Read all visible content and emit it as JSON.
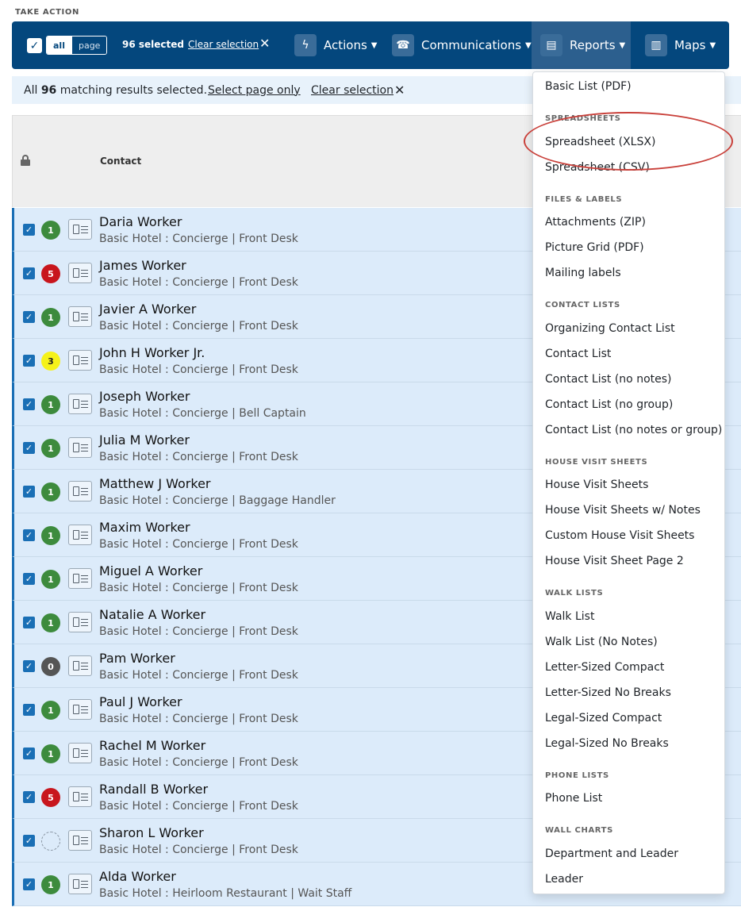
{
  "header": {
    "take_action": "TAKE ACTION"
  },
  "toolbar": {
    "seg_all": "all",
    "seg_page": "page",
    "selected_count": "96 selected",
    "clear_selection": "Clear selection",
    "actions": "Actions",
    "communications": "Communications",
    "reports": "Reports",
    "maps": "Maps"
  },
  "banner": {
    "prefix": "All ",
    "count": "96",
    "suffix": " matching results selected.",
    "select_page_only": "Select page only",
    "clear_selection": "Clear selection"
  },
  "table": {
    "col_contact": "Contact"
  },
  "rows": [
    {
      "name": "Daria Worker",
      "sub": "Basic Hotel : Concierge | Front Desk",
      "badge": "1",
      "badge_color": "#3d8b3d"
    },
    {
      "name": "James Worker",
      "sub": "Basic Hotel : Concierge | Front Desk",
      "badge": "5",
      "badge_color": "#c8161d"
    },
    {
      "name": "Javier A Worker",
      "sub": "Basic Hotel : Concierge | Front Desk",
      "badge": "1",
      "badge_color": "#3d8b3d"
    },
    {
      "name": "John H Worker Jr.",
      "sub": "Basic Hotel : Concierge | Front Desk",
      "badge": "3",
      "badge_color": "#f5f21a"
    },
    {
      "name": "Joseph Worker",
      "sub": "Basic Hotel : Concierge | Bell Captain",
      "badge": "1",
      "badge_color": "#3d8b3d"
    },
    {
      "name": "Julia M Worker",
      "sub": "Basic Hotel : Concierge | Front Desk",
      "badge": "1",
      "badge_color": "#3d8b3d"
    },
    {
      "name": "Matthew J Worker",
      "sub": "Basic Hotel : Concierge | Baggage Handler",
      "badge": "1",
      "badge_color": "#3d8b3d"
    },
    {
      "name": "Maxim Worker",
      "sub": "Basic Hotel : Concierge | Front Desk",
      "badge": "1",
      "badge_color": "#3d8b3d"
    },
    {
      "name": "Miguel A Worker",
      "sub": "Basic Hotel : Concierge | Front Desk",
      "badge": "1",
      "badge_color": "#3d8b3d"
    },
    {
      "name": "Natalie A Worker",
      "sub": "Basic Hotel : Concierge | Front Desk",
      "badge": "1",
      "badge_color": "#3d8b3d"
    },
    {
      "name": "Pam Worker",
      "sub": "Basic Hotel : Concierge | Front Desk",
      "badge": "0",
      "badge_color": "#555555"
    },
    {
      "name": "Paul J Worker",
      "sub": "Basic Hotel : Concierge | Front Desk",
      "badge": "1",
      "badge_color": "#3d8b3d"
    },
    {
      "name": "Rachel M Worker",
      "sub": "Basic Hotel : Concierge | Front Desk",
      "badge": "1",
      "badge_color": "#3d8b3d"
    },
    {
      "name": "Randall B Worker",
      "sub": "Basic Hotel : Concierge | Front Desk",
      "badge": "5",
      "badge_color": "#c8161d"
    },
    {
      "name": "Sharon L Worker",
      "sub": "Basic Hotel : Concierge | Front Desk",
      "badge": "",
      "badge_color": "dashed"
    },
    {
      "name": "Alda Worker",
      "sub": "Basic Hotel : Heirloom Restaurant | Wait Staff",
      "badge": "1",
      "badge_color": "#3d8b3d"
    }
  ],
  "reports_menu": {
    "basic_list": "Basic List (PDF)",
    "h_spreadsheets": "SPREADSHEETS",
    "xlsx": "Spreadsheet (XLSX)",
    "csv": "Spreadsheet (CSV)",
    "h_files": "FILES & LABELS",
    "attachments": "Attachments (ZIP)",
    "picture_grid": "Picture Grid (PDF)",
    "mailing": "Mailing labels",
    "h_contact": "CONTACT LISTS",
    "org_contact": "Organizing Contact List",
    "contact_list": "Contact List",
    "contact_no_notes": "Contact List (no notes)",
    "contact_no_group": "Contact List (no group)",
    "contact_no_both": "Contact List (no notes or group)",
    "h_house": "HOUSE VISIT SHEETS",
    "house": "House Visit Sheets",
    "house_notes": "House Visit Sheets w/ Notes",
    "house_custom": "Custom House Visit Sheets",
    "house_p2": "House Visit Sheet Page 2",
    "h_walk": "WALK LISTS",
    "walk": "Walk List",
    "walk_no_notes": "Walk List (No Notes)",
    "letter_compact": "Letter-Sized Compact",
    "letter_no_breaks": "Letter-Sized No Breaks",
    "legal_compact": "Legal-Sized Compact",
    "legal_no_breaks": "Legal-Sized No Breaks",
    "h_phone": "PHONE LISTS",
    "phone": "Phone List",
    "h_wall": "WALL CHARTS",
    "dept_leader": "Department and Leader",
    "leader": "Leader"
  },
  "colors": {
    "toolbar": "#04477d",
    "row_bg": "#dcebfa",
    "highlight": "#c9403a"
  }
}
